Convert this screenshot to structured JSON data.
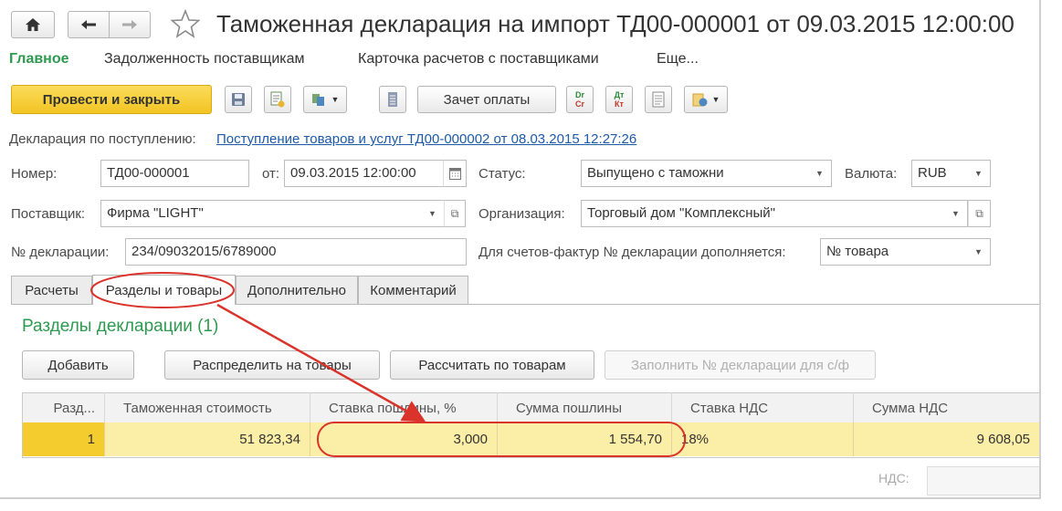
{
  "header": {
    "title": "Таможенная декларация на импорт ТД00-000001 от 09.03.2015 12:00:00"
  },
  "nav": {
    "items": [
      "Главное",
      "Задолженность поставщикам",
      "Карточка расчетов с поставщиками",
      "Еще..."
    ],
    "active_color": "#2e9a4f"
  },
  "toolbar": {
    "post_close": "Провести и закрыть",
    "offset_payment": "Зачет оплаты",
    "dt_kt_1": "Dт\nCт",
    "dt_kt_2": "Дт\nКт",
    "accent": "#f5cc2e"
  },
  "form": {
    "basis_label": "Декларация по поступлению:",
    "basis_link": "Поступление товаров и услуг ТД00-000002 от 08.03.2015 12:27:26",
    "number_label": "Номер:",
    "number_value": "ТД00-000001",
    "from_label": "от:",
    "date_value": "09.03.2015 12:00:00",
    "status_label": "Статус:",
    "status_value": "Выпущено с таможни",
    "currency_label": "Валюта:",
    "currency_value": "RUB",
    "supplier_label": "Поставщик:",
    "supplier_value": "Фирма \"LIGHT\"",
    "org_label": "Организация:",
    "org_value": "Торговый дом \"Комплексный\"",
    "decl_no_label": "№ декларации:",
    "decl_no_value": "234/09032015/6789000",
    "invoice_label": "Для счетов-фактур № декларации дополняется:",
    "invoice_value": "№ товара"
  },
  "tabs": [
    "Расчеты",
    "Разделы и товары",
    "Дополнительно",
    "Комментарий"
  ],
  "section": {
    "title": "Разделы декларации (1)",
    "buttons": {
      "add": "Добавить",
      "distribute": "Распределить на товары",
      "calc": "Рассчитать по товарам",
      "fill": "Заполнить № декларации для с/ф"
    }
  },
  "table": {
    "columns": [
      "Разд...",
      "Таможенная стоимость",
      "Ставка пошлины, %",
      "Сумма пошлины",
      "Ставка НДС",
      "Сумма НДС"
    ],
    "rows": [
      [
        "1",
        "51 823,34",
        "3,000",
        "1 554,70",
        "18%",
        "9 608,05"
      ]
    ],
    "row_highlight": "#fbeea6"
  },
  "footer_partial": "НДС:",
  "annotation_color": "#d9332b"
}
